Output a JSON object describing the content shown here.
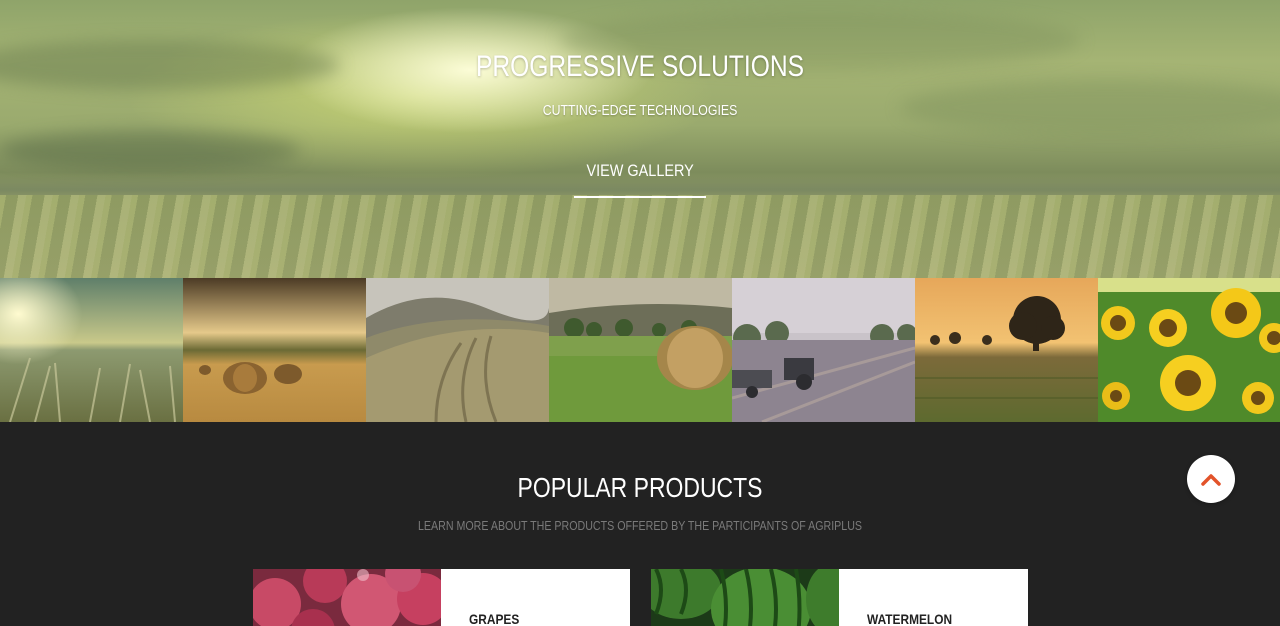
{
  "hero": {
    "title": "PROGRESSIVE SOLUTIONS",
    "subtitle": "CUTTING-EDGE TECHNOLOGIES",
    "button_label": "VIEW GALLERY"
  },
  "gallery": {
    "thumbnails": [
      {
        "subject": "wheat field at sunrise"
      },
      {
        "subject": "hay bales at sunset"
      },
      {
        "subject": "harvested hills"
      },
      {
        "subject": "green field with hay roll"
      },
      {
        "subject": "tractor in field"
      },
      {
        "subject": "tree on field at sunset"
      },
      {
        "subject": "sunflowers"
      }
    ]
  },
  "products": {
    "title": "POPULAR PRODUCTS",
    "subtitle": "LEARN MORE ABOUT THE PRODUCTS OFFERED BY THE PARTICIPANTS OF AGRIPLUS",
    "items": [
      {
        "name": "GRAPES"
      },
      {
        "name": "WATERMELON"
      }
    ]
  },
  "scroll_top": {
    "icon": "chevron-up-icon",
    "color": "#e2532a"
  }
}
